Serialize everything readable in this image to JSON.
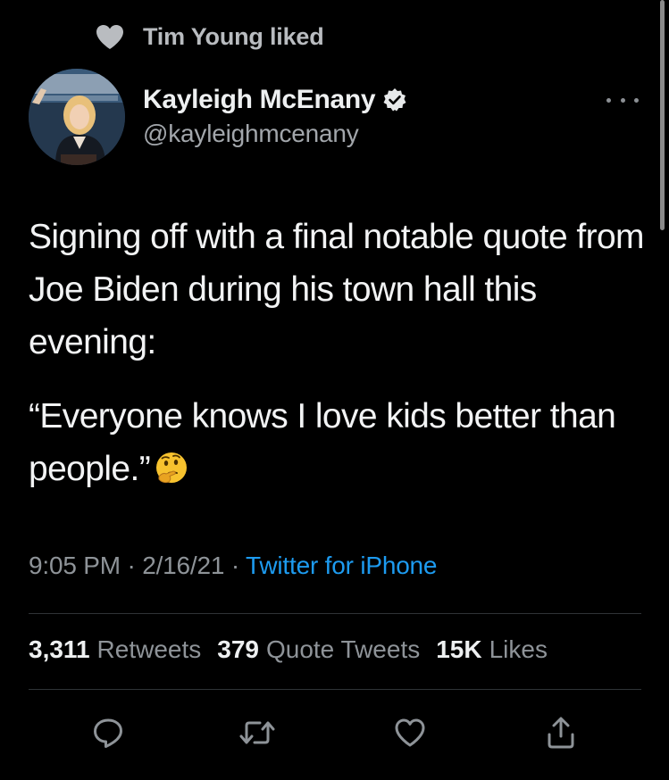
{
  "social_context": {
    "icon": "heart-icon",
    "text": "Tim Young liked"
  },
  "author": {
    "display_name": "Kayleigh McEnany",
    "verified_icon": "verified-badge-icon",
    "handle": "@kayleighmcenany"
  },
  "tweet": {
    "paragraphs": [
      "Signing off with a final notable quote from Joe Biden during his town hall this evening:",
      "“Everyone knows I love kids better than people.”"
    ],
    "emoji": "thinking-face-emoji",
    "time": "9:05 PM",
    "date": "2/16/21",
    "separator": "·",
    "source": "Twitter for iPhone"
  },
  "stats": {
    "retweets": {
      "value": "3,311",
      "label": "Retweets"
    },
    "quote_tweets": {
      "value": "379",
      "label": "Quote Tweets"
    },
    "likes": {
      "value": "15K",
      "label": "Likes"
    }
  },
  "actions": [
    "reply-icon",
    "retweet-icon",
    "like-icon",
    "share-icon"
  ],
  "colors": {
    "background": "#000000",
    "link_blue": "#1d9bf0",
    "secondary_text": "#8e9398",
    "divider": "#2f3336"
  }
}
